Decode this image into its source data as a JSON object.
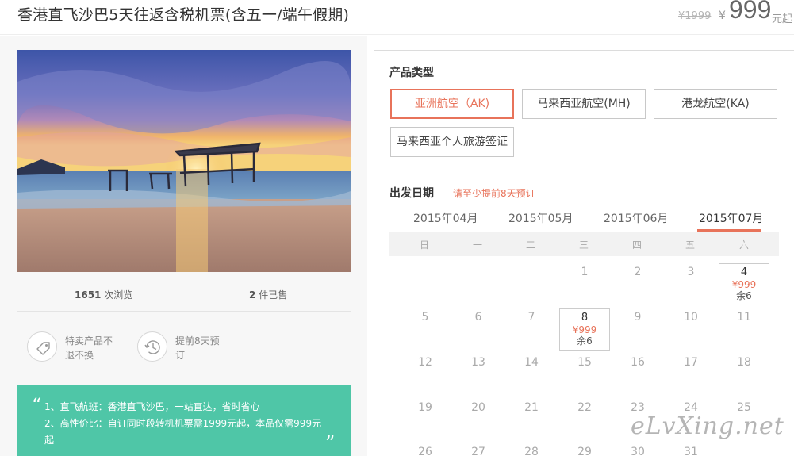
{
  "header": {
    "title": "香港直飞沙巴5天往返含税机票(含五一/端午假期)",
    "original_price": "¥1999",
    "currency_symbol": "¥",
    "current_price": "999",
    "price_suffix": "元起"
  },
  "stats": {
    "views_count": "1651",
    "views_label": "次浏览",
    "sold_count": "2",
    "sold_label": "件已售"
  },
  "features": [
    {
      "icon": "tag-icon",
      "label": "特卖产品不退不换"
    },
    {
      "icon": "history-clock-icon",
      "label": "提前8天预订"
    }
  ],
  "highlights": {
    "lines": [
      "1、直飞航班：香港直飞沙巴，一站直达，省时省心",
      "2、高性价比：自订同时段转机机票需1999元起，本品仅需999元起"
    ]
  },
  "product": {
    "type_title": "产品类型",
    "options": [
      "亚洲航空（AK)",
      "马来西亚航空(MH)",
      "港龙航空(KA)",
      "马来西亚个人旅游签证"
    ],
    "selected_index": 0
  },
  "departure": {
    "title": "出发日期",
    "hint": "请至少提前8天预订",
    "months": [
      "2015年04月",
      "2015年05月",
      "2015年06月",
      "2015年07月"
    ],
    "active_month": "2015年07月",
    "weekdays": [
      "日",
      "一",
      "二",
      "三",
      "四",
      "五",
      "六"
    ],
    "days": [
      "1",
      "2",
      "3",
      "4",
      "5",
      "6",
      "7",
      "8",
      "9",
      "10",
      "11",
      "12",
      "13",
      "14",
      "15",
      "16",
      "17",
      "18",
      "19",
      "20",
      "21",
      "22",
      "23",
      "24",
      "25",
      "26",
      "27",
      "28",
      "29",
      "30",
      "31"
    ],
    "available": [
      {
        "day": "4",
        "price": "¥999",
        "remain": "余6"
      },
      {
        "day": "8",
        "price": "¥999",
        "remain": "余6"
      }
    ]
  },
  "watermark": "eLvXing.net",
  "colors": {
    "accent": "#e8735a",
    "green_banner": "#4fc6a7",
    "text": "#333333",
    "muted": "#aaaaaa"
  }
}
